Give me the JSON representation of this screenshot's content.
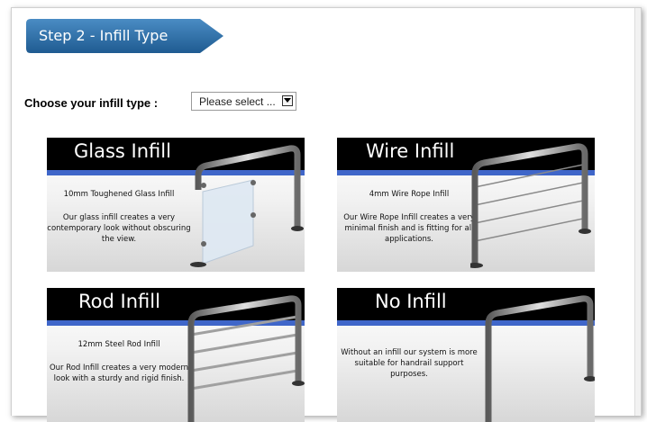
{
  "step": {
    "title": "Step 2 - Infill Type"
  },
  "chooser": {
    "label": "Choose your infill type :",
    "selected": "Please select ..."
  },
  "colors": {
    "tab": "#2e6ea6",
    "stripe": "#3f66c9",
    "header": "#000000"
  },
  "cards": [
    {
      "title": "Glass Infill",
      "spec": "10mm Toughened Glass Infill",
      "description": "Our glass infill creates a very contemporary look without obscuring the view."
    },
    {
      "title": "Wire Infill",
      "spec": "4mm Wire Rope Infill",
      "description": "Our Wire Rope Infill creates a very minimal finish and is fitting for all applications."
    },
    {
      "title": "Rod Infill",
      "spec": "12mm Steel Rod Infill",
      "description": "Our Rod Infill creates a very modern look with a sturdy and rigid finish."
    },
    {
      "title": "No Infill",
      "spec": "",
      "description": "Without an infill our system is more suitable for handrail support purposes."
    }
  ]
}
